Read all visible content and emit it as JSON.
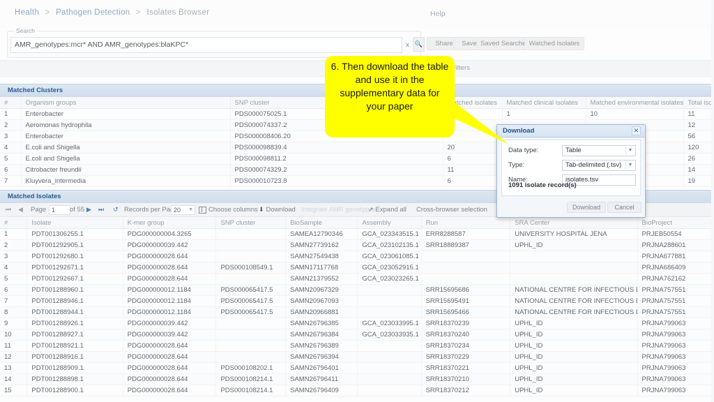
{
  "breadcrumb": {
    "items": [
      "Health",
      "Pathogen Detection",
      "Isolates Browser"
    ],
    "separator": ">"
  },
  "header": {
    "help_label": "Help"
  },
  "search": {
    "legend": "Search",
    "value": "AMR_genotypes:mcr* AND AMR_genotypes:blaKPC*",
    "clear_icon": "x",
    "search_icon": "magnifier-icon"
  },
  "toolbar": {
    "buttons": [
      "Share",
      "Save",
      "Saved Searches",
      "Watched Isolates"
    ]
  },
  "filters": {
    "label": "Filters"
  },
  "clusters": {
    "section_title": "Matched Clusters",
    "columns": [
      "#",
      "Organism groups",
      "SNP cluster",
      "Matched isolates",
      "Matched clinical isolates",
      "Matched environmental isolates",
      "Total isolates"
    ],
    "rows": [
      {
        "n": "1",
        "organism": "Enterobacter",
        "snp": "PDS000075025.1",
        "matched": "",
        "clinical": "1",
        "environmental": "10",
        "total": "11"
      },
      {
        "n": "2",
        "organism": "Aeromonas hydrophila",
        "snp": "PDS000074337.2",
        "matched": "",
        "clinical": "",
        "environmental": "",
        "total": "12"
      },
      {
        "n": "3",
        "organism": "Enterobacter",
        "snp": "PDS000008406.20",
        "matched": "",
        "clinical": "",
        "environmental": "",
        "total": "56"
      },
      {
        "n": "4",
        "organism": "E.coli and Shigella",
        "snp": "PDS000098839.4",
        "matched": "20",
        "clinical": "",
        "environmental": "",
        "total": "120"
      },
      {
        "n": "5",
        "organism": "E.coli and Shigella",
        "snp": "PDS000098811.2",
        "matched": "6",
        "clinical": "",
        "environmental": "",
        "total": "26"
      },
      {
        "n": "6",
        "organism": "Citrobacter freundii",
        "snp": "PDS000074329.2",
        "matched": "11",
        "clinical": "",
        "environmental": "",
        "total": "14"
      },
      {
        "n": "7",
        "organism": "Kluyvera_intermedia",
        "snp": "PDS000010723.8",
        "matched": "6",
        "clinical": "",
        "environmental": "",
        "total": "19"
      }
    ]
  },
  "isolates": {
    "section_title": "Matched Isolates",
    "pager": {
      "first_icon": "first-page-icon",
      "prev_icon": "prev-page-icon",
      "page_label": "Page",
      "page_value": "1",
      "of_label": "of 55",
      "next_icon": "next-page-icon",
      "last_icon": "last-page-icon",
      "refresh_icon": "refresh-icon",
      "records_label": "Records per Page",
      "records_value": "20"
    },
    "actions": {
      "choose_columns": "Choose columns",
      "choose_columns_icon": "columns-icon",
      "download": "Download",
      "download_icon": "download-icon",
      "integrate_amr": "Integrate AMR genotypes",
      "expand_all": "Expand all",
      "expand_icon": "expand-arrows-icon",
      "cross_browser": "Cross-browser selection"
    },
    "columns": [
      "#",
      "Isolate",
      "K-mer group",
      "SNP cluster",
      "BioSample",
      "Assembly",
      "Run",
      "SRA Center",
      "BioProject"
    ],
    "rows": [
      {
        "n": "1",
        "isolate": "PDT001306255.1",
        "kmer": "PDG000000004.3265",
        "snp": "",
        "biosample": "SAMEA12790346",
        "assembly": "GCA_023343515.1",
        "run": "ERR8288587",
        "center": "UNIVERSITY HOSPITAL JENA",
        "bioproject": "PRJEB50554"
      },
      {
        "n": "2",
        "isolate": "PDT001292905.1",
        "kmer": "PDG000000039.442",
        "snp": "",
        "biosample": "SAMN27739162",
        "assembly": "GCA_023102135.1",
        "run": "SRR18889387",
        "center": "UPHL_ID",
        "bioproject": "PRJNA288601"
      },
      {
        "n": "3",
        "isolate": "PDT001292680.1",
        "kmer": "PDG000000028.644",
        "snp": "",
        "biosample": "SAMN27549438",
        "assembly": "GCA_023061085.1",
        "run": "",
        "center": "",
        "bioproject": "PRJNA677881"
      },
      {
        "n": "4",
        "isolate": "PDT001292671.1",
        "kmer": "PDG000000028.644",
        "snp": "PDS000108549.1",
        "biosample": "SAMN17117768",
        "assembly": "GCA_023052915.1",
        "run": "",
        "center": "",
        "bioproject": "PRJNA686409"
      },
      {
        "n": "5",
        "isolate": "PDT001292667.1",
        "kmer": "PDG000000028.644",
        "snp": "",
        "biosample": "SAMN21379552",
        "assembly": "GCA_023023265.1",
        "run": "",
        "center": "",
        "bioproject": "PRJNA762162"
      },
      {
        "n": "6",
        "isolate": "PDT001288960.1",
        "kmer": "PDG000000012.1184",
        "snp": "PDS000065417.5",
        "biosample": "SAMN20967329",
        "assembly": "",
        "run": "SRR15695686",
        "center": "NATIONAL CENTRE FOR INFECTIOUS DISEASES",
        "bioproject": "PRJNA757551"
      },
      {
        "n": "7",
        "isolate": "PDT001288946.1",
        "kmer": "PDG000000012.1184",
        "snp": "PDS000065417.5",
        "biosample": "SAMN20967093",
        "assembly": "",
        "run": "SRR15695491",
        "center": "NATIONAL CENTRE FOR INFECTIOUS DISEASES",
        "bioproject": "PRJNA757551"
      },
      {
        "n": "8",
        "isolate": "PDT001288944.1",
        "kmer": "PDG000000012.1184",
        "snp": "PDS000065417.5",
        "biosample": "SAMN20966881",
        "assembly": "",
        "run": "SRR15695466",
        "center": "NATIONAL CENTRE FOR INFECTIOUS DISEASES",
        "bioproject": "PRJNA757551"
      },
      {
        "n": "9",
        "isolate": "PDT001288926.1",
        "kmer": "PDG000000039.442",
        "snp": "",
        "biosample": "SAMN26796385",
        "assembly": "GCA_023033995.1",
        "run": "SRR18370239",
        "center": "UPHL_ID",
        "bioproject": "PRJNA799063"
      },
      {
        "n": "10",
        "isolate": "PDT001288927.1",
        "kmer": "PDG000000039.442",
        "snp": "",
        "biosample": "SAMN26796384",
        "assembly": "GCA_023033935.1",
        "run": "SRR18370240",
        "center": "UPHL_ID",
        "bioproject": "PRJNA799063"
      },
      {
        "n": "11",
        "isolate": "PDT001288921.1",
        "kmer": "PDG000000028.644",
        "snp": "",
        "biosample": "SAMN26796389",
        "assembly": "",
        "run": "SRR18370234",
        "center": "UPHL_ID",
        "bioproject": "PRJNA799063"
      },
      {
        "n": "12",
        "isolate": "PDT001288916.1",
        "kmer": "PDG000000028.644",
        "snp": "",
        "biosample": "SAMN26796394",
        "assembly": "",
        "run": "SRR18370229",
        "center": "UPHL_ID",
        "bioproject": "PRJNA799063"
      },
      {
        "n": "13",
        "isolate": "PDT001288909.1",
        "kmer": "PDG000000028.644",
        "snp": "PDS000108202.1",
        "biosample": "SAMN26796401",
        "assembly": "",
        "run": "SRR18370221",
        "center": "UPHL_ID",
        "bioproject": "PRJNA799063"
      },
      {
        "n": "14",
        "isolate": "PDT001288898.1",
        "kmer": "PDG000000028.644",
        "snp": "PDS000108214.1",
        "biosample": "SAMN26796411",
        "assembly": "",
        "run": "SRR18370210",
        "center": "UPHL_ID",
        "bioproject": "PRJNA799063"
      },
      {
        "n": "15",
        "isolate": "PDT001288900.1",
        "kmer": "PDG000000028.644",
        "snp": "PDS000108214.1",
        "biosample": "SAMN26796409",
        "assembly": "",
        "run": "SRR18370212",
        "center": "UPHL_ID",
        "bioproject": "PRJNA799063"
      }
    ]
  },
  "download_dialog": {
    "title": "Download",
    "close_icon": "close-icon",
    "fields": [
      {
        "label": "Data type:",
        "value": "Table",
        "control": "select"
      },
      {
        "label": "Type:",
        "value": "Tab-delimited (.tsv)",
        "control": "select"
      },
      {
        "label": "Name:",
        "value": "isolates.tsv",
        "control": "text"
      }
    ],
    "record_count": "1091 isolate record(s)",
    "confirm_label": "Download",
    "cancel_label": "Cancel"
  },
  "callout": {
    "text": "6. Then download the table and use it in the supplementary data for your paper",
    "color": "#ffff00"
  },
  "colors": {
    "accent": "#2b5b92",
    "link": "#9fb6d2",
    "highlight": "#ffff00",
    "modal_border": "#9fb8d4"
  }
}
